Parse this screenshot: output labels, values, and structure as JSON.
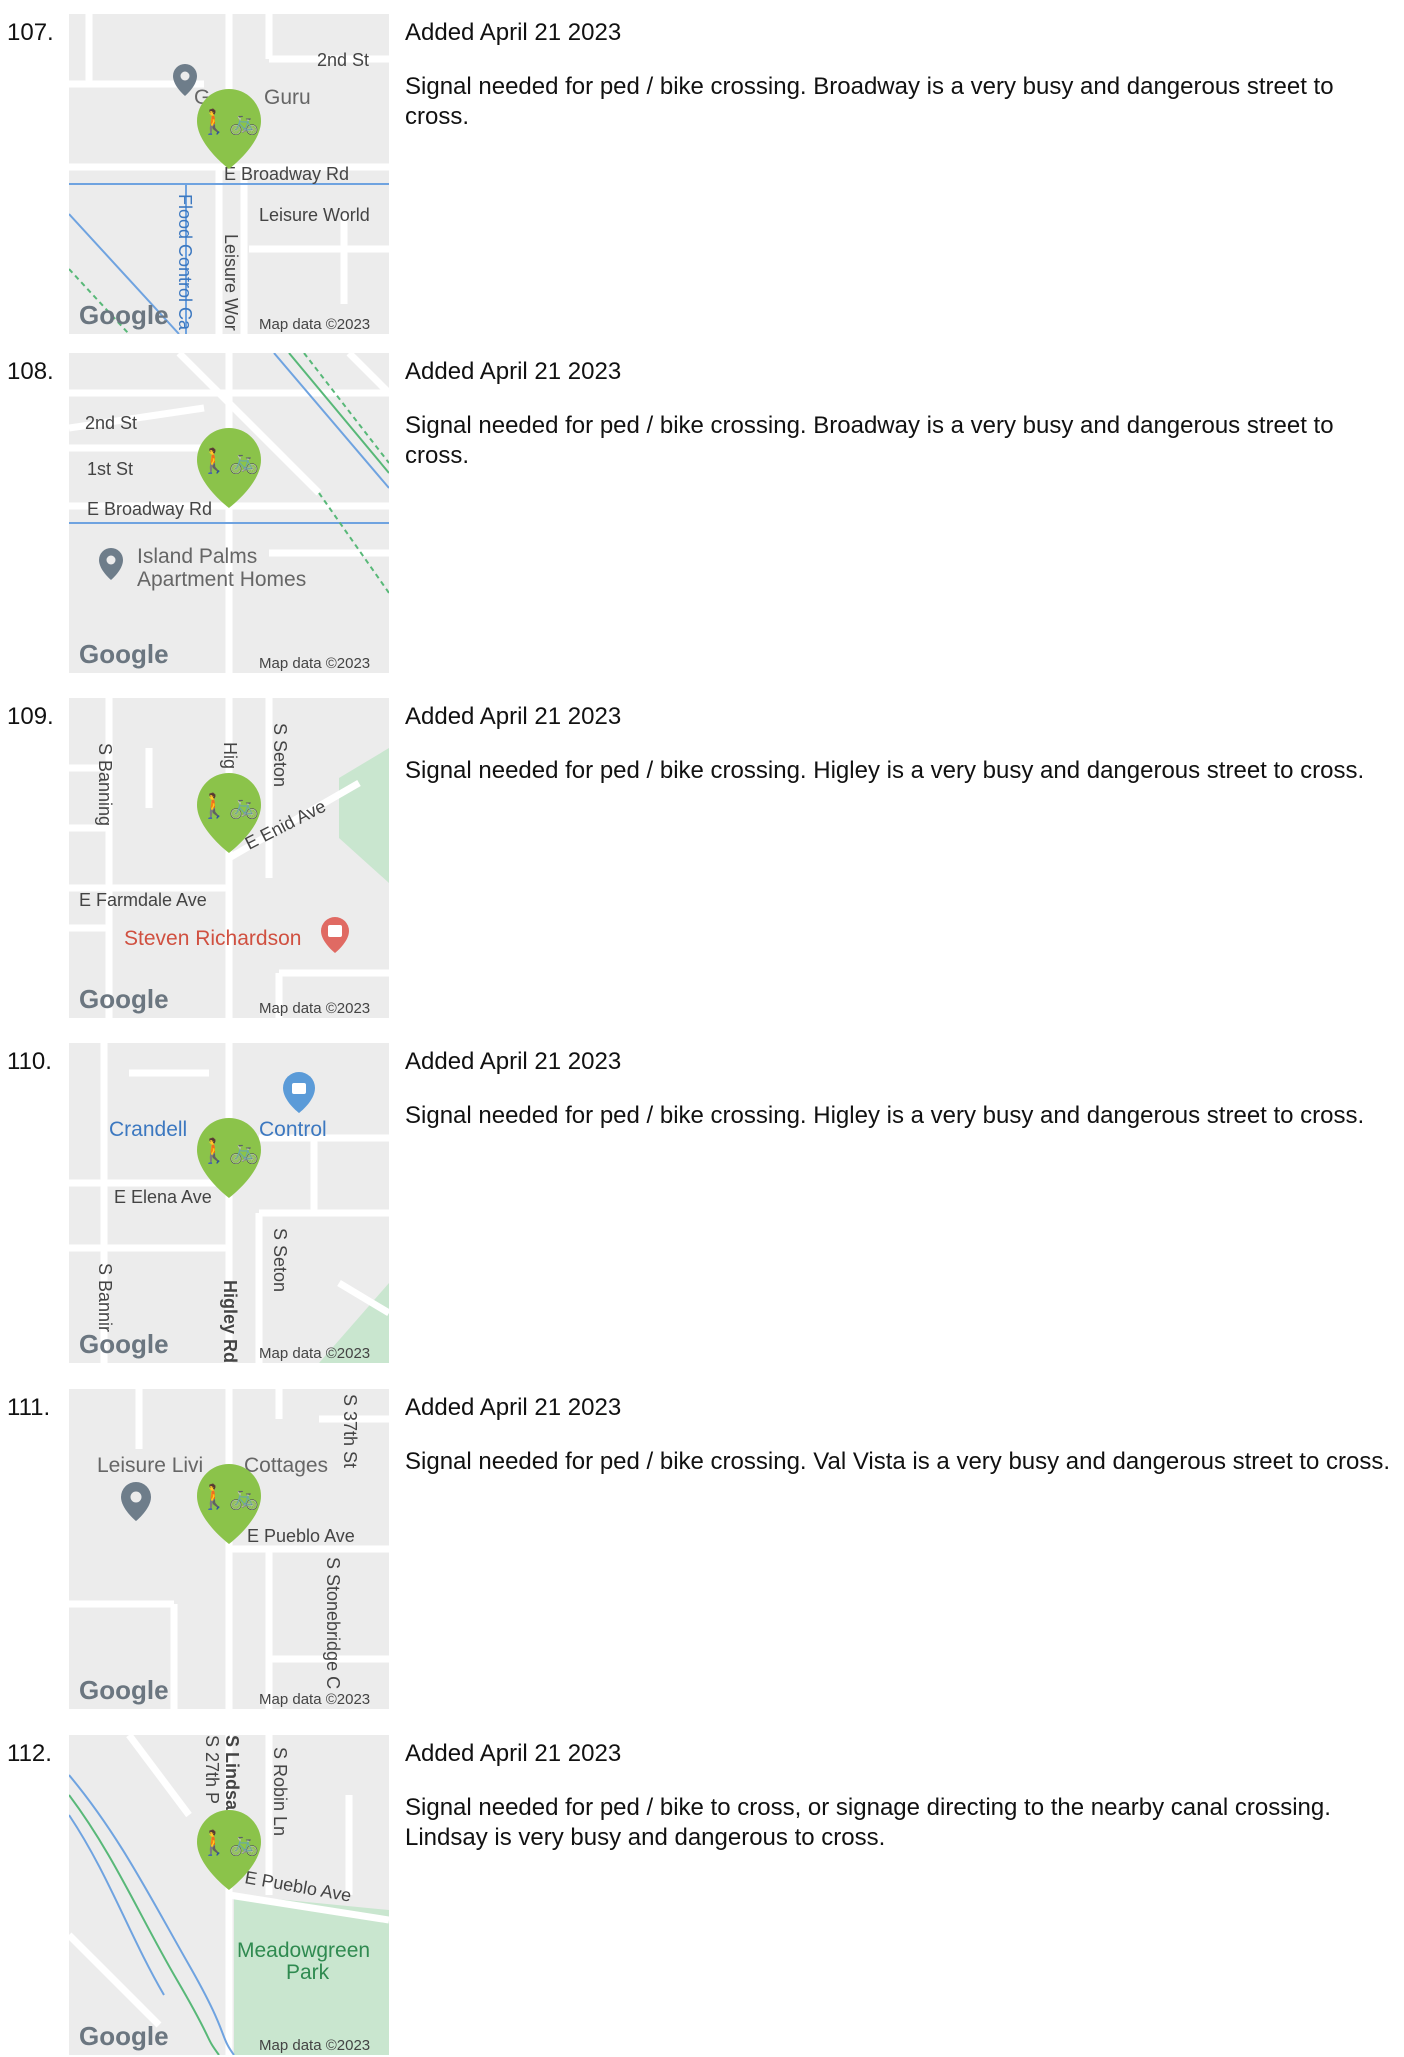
{
  "entries": [
    {
      "number": "107.",
      "added": "Added April 21 2023",
      "description": "Signal needed for ped / bike crossing. Broadway is a very busy and dangerous street to cross.",
      "map": {
        "labels": [
          "2nd St",
          "E Broadway Rd",
          "Leisure World",
          "Flood Control Ca",
          "Leisure Wor",
          "Guru",
          "G"
        ],
        "logo": "Google",
        "attribution": "Map data ©2023"
      }
    },
    {
      "number": "108.",
      "added": "Added April 21 2023",
      "description": "Signal needed for ped / bike crossing. Broadway is a very busy and dangerous street to cross.",
      "map": {
        "labels": [
          "2nd St",
          "1st St",
          "E Broadway Rd",
          "Island Palms",
          "Apartment Homes"
        ],
        "logo": "Google",
        "attribution": "Map data ©2023"
      }
    },
    {
      "number": "109.",
      "added": "Added April 21 2023",
      "description": "Signal needed for ped / bike crossing. Higley is a very busy and dangerous street to cross.",
      "map": {
        "labels": [
          "S Banning",
          "Hig",
          "S Seton",
          "E Enid Ave",
          "E Farmdale Ave",
          "Steven Richardson"
        ],
        "logo": "Google",
        "attribution": "Map data ©2023"
      }
    },
    {
      "number": "110.",
      "added": "Added April 21 2023",
      "description": "Signal needed for ped / bike crossing. Higley is a very busy and dangerous street to cross.",
      "map": {
        "labels": [
          "Crandell",
          "Control",
          "E Elena Ave",
          "S Seton",
          "S Bannir",
          "Higley Rd"
        ],
        "logo": "Google",
        "attribution": "Map data ©2023"
      }
    },
    {
      "number": "111.",
      "added": "Added April 21 2023",
      "description": "Signal needed for ped / bike crossing. Val Vista is a very busy and dangerous street to cross.",
      "map": {
        "labels": [
          "S 37th St",
          "Leisure Livi",
          "Cottages",
          "E Pueblo Ave",
          "S Stonebridge C"
        ],
        "logo": "Google",
        "attribution": "Map data ©2023"
      }
    },
    {
      "number": "112.",
      "added": "Added April 21 2023",
      "description": "Signal needed for ped / bike to cross, or signage directing to the nearby canal crossing. Lindsay is very busy and dangerous to cross.",
      "map": {
        "labels": [
          "S Lindsa",
          "S 27th P",
          "S Robin Ln",
          "E Pueblo Ave",
          "Meadowgreen",
          "Park"
        ],
        "logo": "Google",
        "attribution": "Map data ©2023"
      }
    }
  ],
  "colors": {
    "marker": "#8bc34a",
    "water_line": "#6fa3e0",
    "park": "#c9e6cf",
    "road": "#ffffff",
    "land": "#ececec"
  },
  "icons": {
    "marker": "walk-bike-marker-icon",
    "place_pin": "place-pin-icon",
    "hospital_pin": "hospital-pin-icon",
    "shopping_pin": "shopping-pin-icon"
  }
}
